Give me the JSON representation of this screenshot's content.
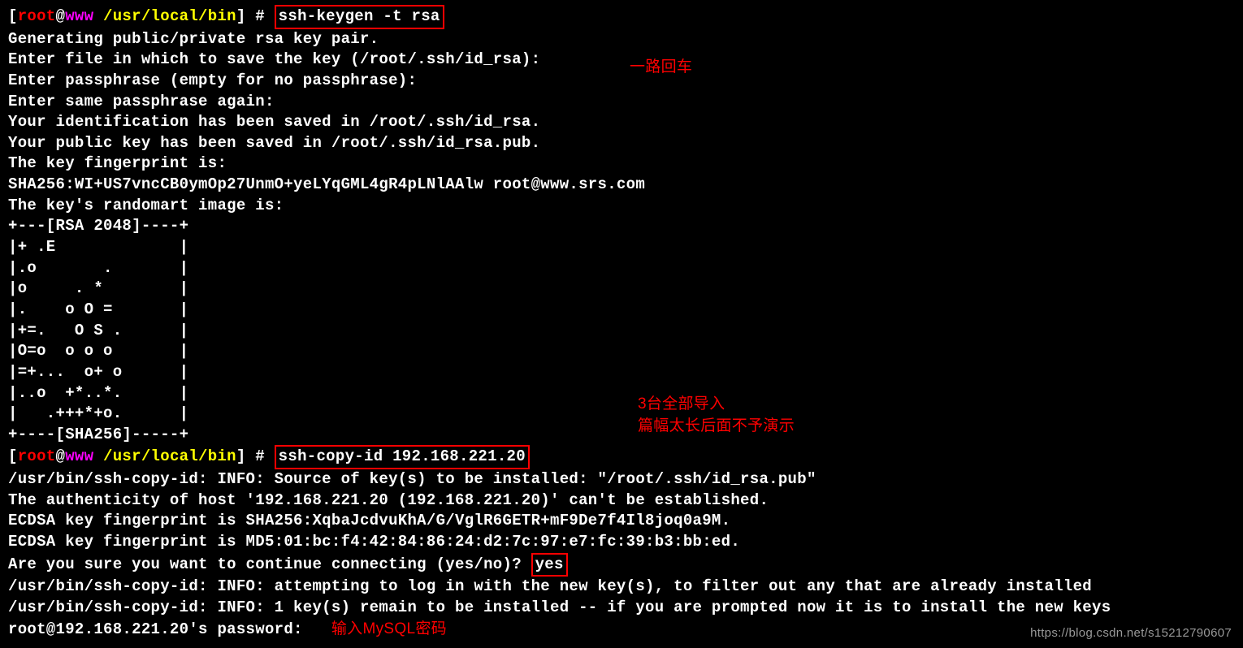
{
  "prompt": {
    "bracket_open": "[",
    "user": "root",
    "at": "@",
    "host": "www",
    "path": " /usr/local/bin",
    "bracket_close": "]",
    "hash": " # "
  },
  "cmd1": "ssh-keygen -t rsa",
  "output": {
    "l1": "Generating public/private rsa key pair.",
    "l2": "Enter file in which to save the key (/root/.ssh/id_rsa):",
    "l3": "Enter passphrase (empty for no passphrase):",
    "l4": "Enter same passphrase again:",
    "l5": "Your identification has been saved in /root/.ssh/id_rsa.",
    "l6": "Your public key has been saved in /root/.ssh/id_rsa.pub.",
    "l7": "The key fingerprint is:",
    "l8": "SHA256:WI+US7vncCB0ymOp27UnmO+yeLYqGML4gR4pLNlAAlw root@www.srs.com",
    "l9": "The key's randomart image is:",
    "r1": "+---[RSA 2048]----+",
    "r2": "|+ .E             |",
    "r3": "|.o       .       |",
    "r4": "|o     . *        |",
    "r5": "|.    o O =       |",
    "r6": "|+=.   O S .      |",
    "r7": "|O=o  o o o       |",
    "r8": "|=+...  o+ o      |",
    "r9": "|..o  +*..*.      |",
    "r10": "|   .+++*+o.      |",
    "r11": "+----[SHA256]-----+"
  },
  "cmd2": "ssh-copy-id 192.168.221.20",
  "output2": {
    "l1": "/usr/bin/ssh-copy-id: INFO: Source of key(s) to be installed: \"/root/.ssh/id_rsa.pub\"",
    "l2": "The authenticity of host '192.168.221.20 (192.168.221.20)' can't be established.",
    "l3": "ECDSA key fingerprint is SHA256:XqbaJcdvuKhA/G/VglR6GETR+mF9De7f4Il8joq0a9M.",
    "l4": "ECDSA key fingerprint is MD5:01:bc:f4:42:84:86:24:d2:7c:97:e7:fc:39:b3:bb:ed.",
    "l5a": "Are you sure you want to continue connecting (yes/no)? ",
    "l5yes": "yes",
    "l6": "/usr/bin/ssh-copy-id: INFO: attempting to log in with the new key(s), to filter out any that are already installed",
    "l7": "/usr/bin/ssh-copy-id: INFO: 1 key(s) remain to be installed -- if you are prompted now it is to install the new keys",
    "l8": "root@192.168.221.20's password: "
  },
  "annotations": {
    "a1": "一路回车",
    "a2": "3台全部导入",
    "a3": "篇幅太长后面不予演示",
    "a4": "输入MySQL密码"
  },
  "watermark": "https://blog.csdn.net/s15212790607"
}
